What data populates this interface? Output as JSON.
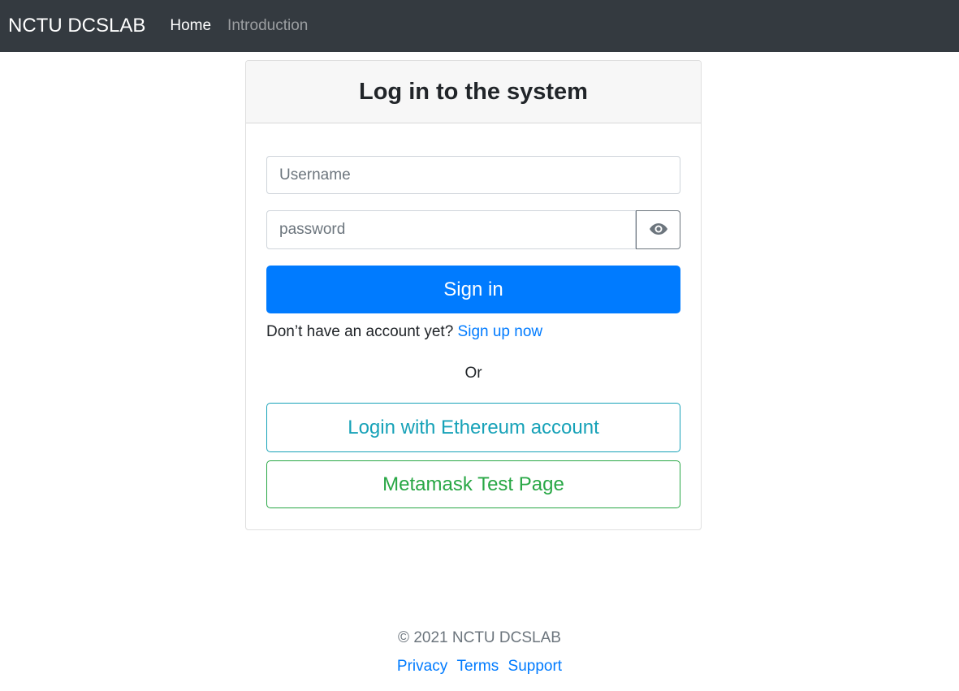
{
  "navbar": {
    "brand": "NCTU DCSLAB",
    "links": [
      {
        "label": "Home",
        "active": true
      },
      {
        "label": "Introduction",
        "active": false
      }
    ]
  },
  "login_card": {
    "title": "Log in to the system",
    "username_placeholder": "Username",
    "password_placeholder": "password",
    "toggle_icon": "eye-icon",
    "sign_in_label": "Sign in",
    "signup_prompt": "Don’t have an account yet?",
    "signup_link": "Sign up now",
    "or_text": "Or",
    "ethereum_button": "Login with Ethereum account",
    "metamask_button": "Metamask Test Page"
  },
  "footer": {
    "copyright": "© 2021 NCTU DCSLAB",
    "links": [
      "Privacy",
      "Terms",
      "Support"
    ]
  },
  "colors": {
    "navbar_bg": "#343a40",
    "primary": "#007bff",
    "info": "#17a2b8",
    "success": "#28a745",
    "muted": "#6c757d"
  }
}
